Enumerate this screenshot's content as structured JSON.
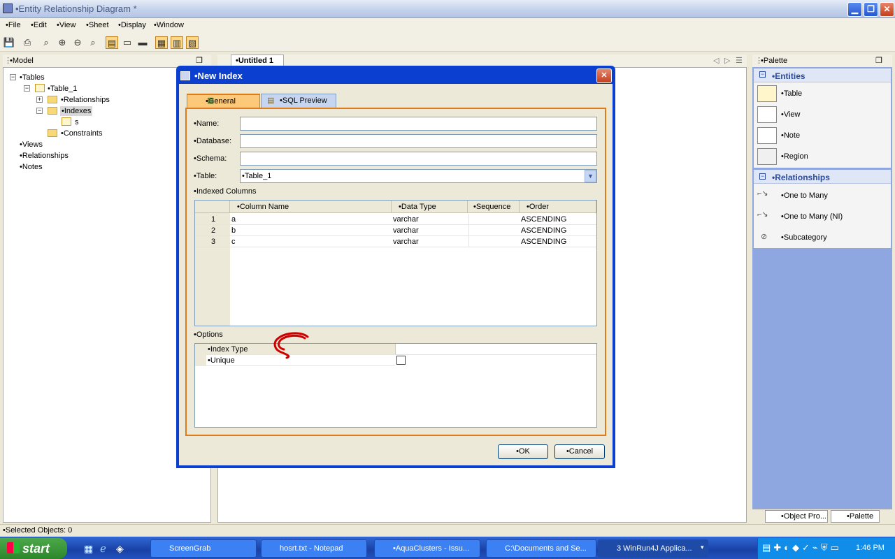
{
  "window": {
    "title": "•Entity Relationship Diagram *",
    "min": "▁",
    "max": "❐",
    "close": "✕"
  },
  "menu": [
    "•File",
    "•Edit",
    "•View",
    "•Sheet",
    "•Display",
    "•Window"
  ],
  "model": {
    "header": "•Model",
    "tree": [
      "•Tables",
      "•Table_1",
      "•Relationships",
      "•Indexes",
      "s",
      "•Constraints",
      "•Views",
      "•Relationships",
      "•Notes"
    ]
  },
  "doc": {
    "tab": "•Untitled 1"
  },
  "palette": {
    "header": "•Palette",
    "entities_title": "•Entities",
    "entities": [
      "•Table",
      "•View",
      "•Note",
      "•Region"
    ],
    "relationships_title": "•Relationships",
    "relationships": [
      "•One to Many",
      "•One to Many (NI)",
      "•Subcategory"
    ],
    "bottom_tabs": [
      "•Object Pro...",
      "•Palette"
    ]
  },
  "status": "•Selected Objects: 0",
  "dialog": {
    "title": "•New Index",
    "tabs": [
      "•General",
      "•SQL Preview"
    ],
    "labels": {
      "name": "•Name:",
      "database": "•Database:",
      "schema": "•Schema:",
      "table": "•Table:"
    },
    "values": {
      "name": "",
      "database": "",
      "schema": "",
      "table": "•Table_1"
    },
    "indexed_columns": "•Indexed Columns",
    "columns": [
      "•Column Name",
      "•Data Type",
      "•Sequence",
      "•Order"
    ],
    "rows": [
      [
        "1",
        "a",
        "varchar",
        "",
        "ASCENDING"
      ],
      [
        "2",
        "b",
        "varchar",
        "",
        "ASCENDING"
      ],
      [
        "3",
        "c",
        "varchar",
        "",
        "ASCENDING"
      ]
    ],
    "options_title": "•Options",
    "options": [
      "•Index Type",
      "•Unique"
    ],
    "ok": "•OK",
    "cancel": "•Cancel"
  },
  "taskbar": {
    "start": "start",
    "tasks": [
      "ScreenGrab",
      "hosrt.txt - Notepad",
      "•AquaClusters - Issu...",
      "C:\\Documents and Se...",
      "3 WinRun4J Applica..."
    ],
    "clock": "1:46 PM"
  },
  "colors": {
    "title_blue": "#0a3fd0",
    "tab_orange": "#e07b19",
    "palette_bg": "#8fa7e0",
    "annotation_red": "#cc0000"
  }
}
